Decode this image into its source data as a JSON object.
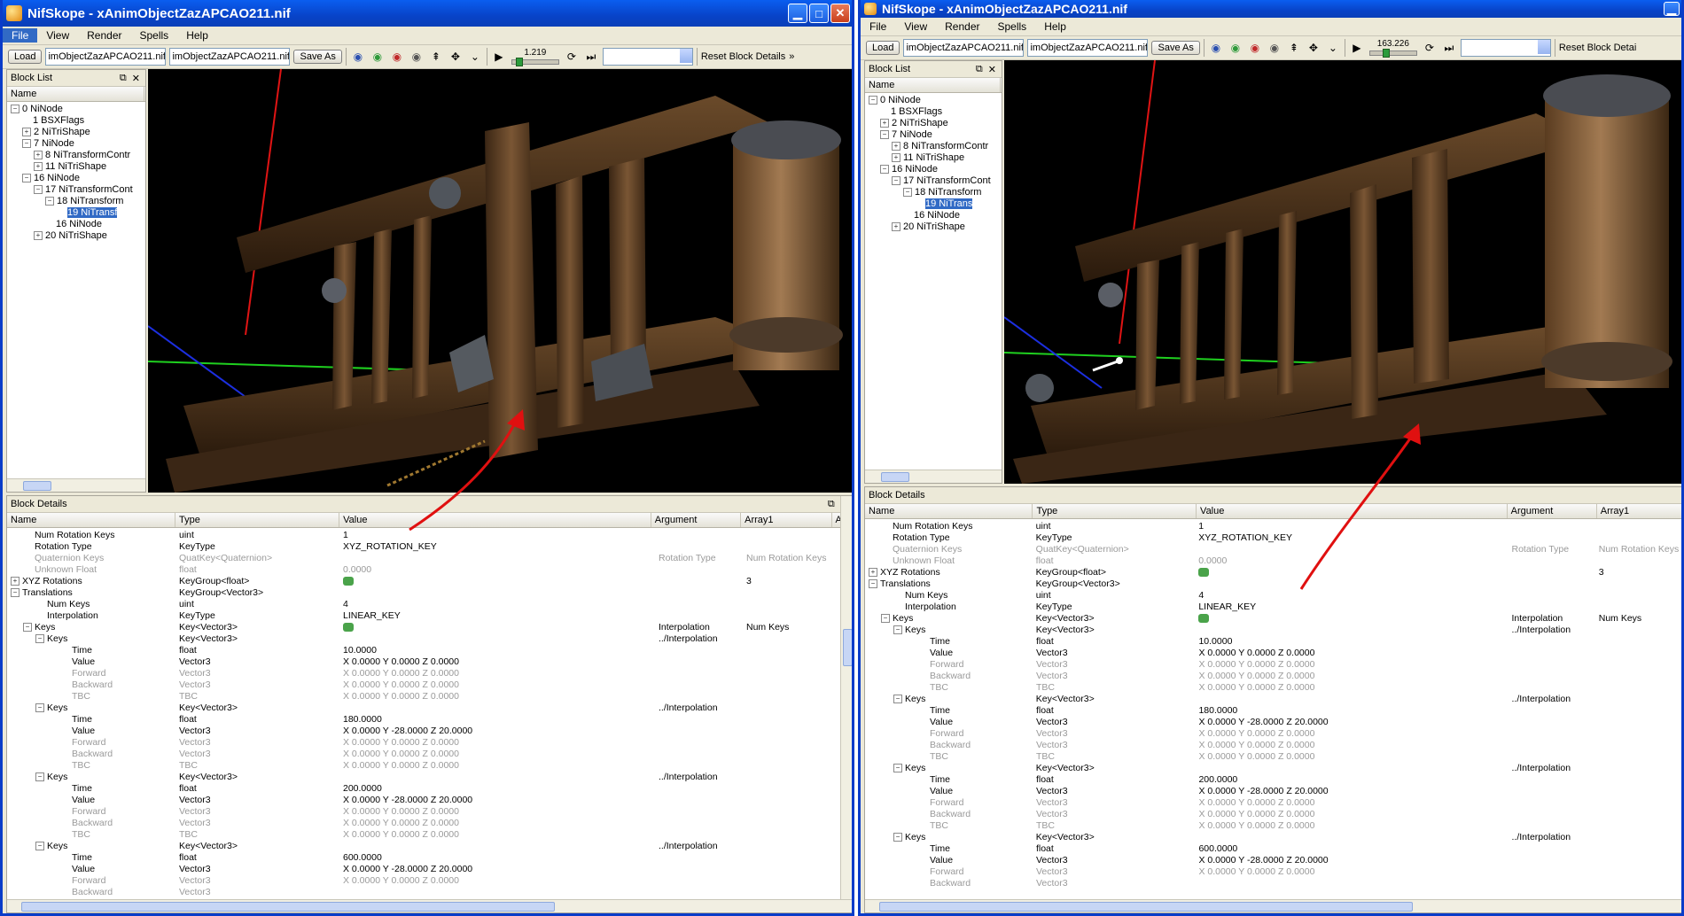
{
  "colors": {
    "titlebar": "#0a5ef0",
    "accent": "#316ac5",
    "arrow": "#e01010"
  },
  "win1": {
    "title": "NifSkope - xAnimObjectZazAPCAO211.nif",
    "menu": [
      "File",
      "View",
      "Render",
      "Spells",
      "Help"
    ],
    "toolbar": {
      "load": "Load",
      "file1": "imObjectZazAPCAO211.nif",
      "file2": "imObjectZazAPCAO211.nif",
      "save_as": "Save As",
      "time": "1.219",
      "reset": "Reset Block Details",
      "more": "»"
    },
    "block_list": {
      "title": "Block List",
      "col": "Name",
      "rows": [
        {
          "label": "0 NiNode",
          "exp": "−",
          "indent": 0
        },
        {
          "label": "1 BSXFlags",
          "exp": "",
          "indent": 1
        },
        {
          "label": "2 NiTriShape",
          "exp": "+",
          "indent": 1
        },
        {
          "label": "7 NiNode",
          "exp": "−",
          "indent": 1
        },
        {
          "label": "8 NiTransformContr",
          "exp": "+",
          "indent": 2
        },
        {
          "label": "11 NiTriShape",
          "exp": "+",
          "indent": 2
        },
        {
          "label": "16 NiNode",
          "exp": "−",
          "indent": 1
        },
        {
          "label": "17 NiTransformCont",
          "exp": "−",
          "indent": 2
        },
        {
          "label": "18 NiTransform",
          "exp": "−",
          "indent": 3
        },
        {
          "label": "19 NiTransf",
          "exp": "",
          "indent": 4,
          "selected": true
        },
        {
          "label": "16 NiNode",
          "exp": "",
          "indent": 3
        },
        {
          "label": "20 NiTriShape",
          "exp": "+",
          "indent": 2
        }
      ]
    },
    "details": {
      "title": "Block Details",
      "cols": [
        "Name",
        "Type",
        "Value",
        "Argument",
        "Array1",
        "Ar"
      ],
      "rows": [
        {
          "n": "Num Rotation Keys",
          "t": "uint",
          "v": "1",
          "a": "",
          "a1": "",
          "i": 1
        },
        {
          "n": "Rotation Type",
          "t": "KeyType",
          "v": "XYZ_ROTATION_KEY",
          "a": "",
          "a1": "",
          "i": 1
        },
        {
          "n": "Quaternion Keys",
          "t": "QuatKey<Quaternion>",
          "v": "",
          "a": "Rotation Type",
          "a1": "Num Rotation Keys",
          "i": 1,
          "g": true
        },
        {
          "n": "Unknown Float",
          "t": "float",
          "v": "0.0000",
          "a": "",
          "a1": "",
          "i": 1,
          "g": true
        },
        {
          "n": "XYZ Rotations",
          "t": "KeyGroup<float>",
          "v": "",
          "icon": true,
          "a": "",
          "a1": "3",
          "i": 0,
          "e": "+"
        },
        {
          "n": "Translations",
          "t": "KeyGroup<Vector3>",
          "v": "",
          "a": "",
          "a1": "",
          "i": 0,
          "e": "−"
        },
        {
          "n": "Num Keys",
          "t": "uint",
          "v": "4",
          "a": "",
          "a1": "",
          "i": 2
        },
        {
          "n": "Interpolation",
          "t": "KeyType",
          "v": "LINEAR_KEY",
          "a": "",
          "a1": "",
          "i": 2
        },
        {
          "n": "Keys",
          "t": "Key<Vector3>",
          "v": "",
          "icon": true,
          "a": "Interpolation",
          "a1": "Num Keys",
          "i": 1,
          "e": "−"
        },
        {
          "n": "Keys",
          "t": "Key<Vector3>",
          "v": "",
          "a": "../Interpolation",
          "a1": "",
          "i": 2,
          "e": "−"
        },
        {
          "n": "Time",
          "t": "float",
          "v": "10.0000",
          "a": "",
          "a1": "",
          "i": 4
        },
        {
          "n": "Value",
          "t": "Vector3",
          "v": "X 0.0000 Y 0.0000 Z 0.0000",
          "a": "",
          "a1": "",
          "i": 4
        },
        {
          "n": "Forward",
          "t": "Vector3",
          "v": "X 0.0000 Y 0.0000 Z 0.0000",
          "a": "",
          "a1": "",
          "i": 4,
          "g": true
        },
        {
          "n": "Backward",
          "t": "Vector3",
          "v": "X 0.0000 Y 0.0000 Z 0.0000",
          "a": "",
          "a1": "",
          "i": 4,
          "g": true
        },
        {
          "n": "TBC",
          "t": "TBC",
          "v": "X 0.0000 Y 0.0000 Z 0.0000",
          "a": "",
          "a1": "",
          "i": 4,
          "g": true
        },
        {
          "n": "Keys",
          "t": "Key<Vector3>",
          "v": "",
          "a": "../Interpolation",
          "a1": "",
          "i": 2,
          "e": "−"
        },
        {
          "n": "Time",
          "t": "float",
          "v": "180.0000",
          "a": "",
          "a1": "",
          "i": 4
        },
        {
          "n": "Value",
          "t": "Vector3",
          "v": "X 0.0000 Y -28.0000 Z 20.0000",
          "a": "",
          "a1": "",
          "i": 4
        },
        {
          "n": "Forward",
          "t": "Vector3",
          "v": "X 0.0000 Y 0.0000 Z 0.0000",
          "a": "",
          "a1": "",
          "i": 4,
          "g": true
        },
        {
          "n": "Backward",
          "t": "Vector3",
          "v": "X 0.0000 Y 0.0000 Z 0.0000",
          "a": "",
          "a1": "",
          "i": 4,
          "g": true
        },
        {
          "n": "TBC",
          "t": "TBC",
          "v": "X 0.0000 Y 0.0000 Z 0.0000",
          "a": "",
          "a1": "",
          "i": 4,
          "g": true
        },
        {
          "n": "Keys",
          "t": "Key<Vector3>",
          "v": "",
          "a": "../Interpolation",
          "a1": "",
          "i": 2,
          "e": "−"
        },
        {
          "n": "Time",
          "t": "float",
          "v": "200.0000",
          "a": "",
          "a1": "",
          "i": 4
        },
        {
          "n": "Value",
          "t": "Vector3",
          "v": "X 0.0000 Y -28.0000 Z 20.0000",
          "a": "",
          "a1": "",
          "i": 4
        },
        {
          "n": "Forward",
          "t": "Vector3",
          "v": "X 0.0000 Y 0.0000 Z 0.0000",
          "a": "",
          "a1": "",
          "i": 4,
          "g": true
        },
        {
          "n": "Backward",
          "t": "Vector3",
          "v": "X 0.0000 Y 0.0000 Z 0.0000",
          "a": "",
          "a1": "",
          "i": 4,
          "g": true
        },
        {
          "n": "TBC",
          "t": "TBC",
          "v": "X 0.0000 Y 0.0000 Z 0.0000",
          "a": "",
          "a1": "",
          "i": 4,
          "g": true
        },
        {
          "n": "Keys",
          "t": "Key<Vector3>",
          "v": "",
          "a": "../Interpolation",
          "a1": "",
          "i": 2,
          "e": "−"
        },
        {
          "n": "Time",
          "t": "float",
          "v": "600.0000",
          "a": "",
          "a1": "",
          "i": 4
        },
        {
          "n": "Value",
          "t": "Vector3",
          "v": "X 0.0000 Y -28.0000 Z 20.0000",
          "a": "",
          "a1": "",
          "i": 4
        },
        {
          "n": "Forward",
          "t": "Vector3",
          "v": "X 0.0000 Y 0.0000 Z 0.0000",
          "a": "",
          "a1": "",
          "i": 4,
          "g": true
        },
        {
          "n": "Backward",
          "t": "Vector3",
          "v": "",
          "a": "",
          "a1": "",
          "i": 4,
          "g": true
        }
      ]
    }
  },
  "win2": {
    "title": "NifSkope - xAnimObjectZazAPCAO211.nif",
    "menu": [
      "File",
      "View",
      "Render",
      "Spells",
      "Help"
    ],
    "toolbar": {
      "load": "Load",
      "file1": "imObjectZazAPCAO211.nif",
      "file2": "imObjectZazAPCAO211.nif",
      "save_as": "Save As",
      "time": "163.226",
      "reset": "Reset Block Detai"
    },
    "block_list": {
      "title": "Block List",
      "col": "Name",
      "rows": [
        {
          "label": "0 NiNode",
          "exp": "−",
          "indent": 0
        },
        {
          "label": "1 BSXFlags",
          "exp": "",
          "indent": 1
        },
        {
          "label": "2 NiTriShape",
          "exp": "+",
          "indent": 1
        },
        {
          "label": "7 NiNode",
          "exp": "−",
          "indent": 1
        },
        {
          "label": "8 NiTransformContr",
          "exp": "+",
          "indent": 2
        },
        {
          "label": "11 NiTriShape",
          "exp": "+",
          "indent": 2
        },
        {
          "label": "16 NiNode",
          "exp": "−",
          "indent": 1
        },
        {
          "label": "17 NiTransformCont",
          "exp": "−",
          "indent": 2
        },
        {
          "label": "18 NiTransform",
          "exp": "−",
          "indent": 3
        },
        {
          "label": "19 NiTrans",
          "exp": "",
          "indent": 4,
          "selected": true
        },
        {
          "label": "16 NiNode",
          "exp": "",
          "indent": 3
        },
        {
          "label": "20 NiTriShape",
          "exp": "+",
          "indent": 2
        }
      ]
    },
    "details": {
      "title": "Block Details",
      "cols": [
        "Name",
        "Type",
        "Value",
        "Argument",
        "Array1"
      ],
      "rows": [
        {
          "n": "Num Rotation Keys",
          "t": "uint",
          "v": "1",
          "a": "",
          "a1": "",
          "i": 1
        },
        {
          "n": "Rotation Type",
          "t": "KeyType",
          "v": "XYZ_ROTATION_KEY",
          "a": "",
          "a1": "",
          "i": 1
        },
        {
          "n": "Quaternion Keys",
          "t": "QuatKey<Quaternion>",
          "v": "",
          "a": "Rotation Type",
          "a1": "Num Rotation Keys",
          "i": 1,
          "g": true
        },
        {
          "n": "Unknown Float",
          "t": "float",
          "v": "0.0000",
          "a": "",
          "a1": "",
          "i": 1,
          "g": true
        },
        {
          "n": "XYZ Rotations",
          "t": "KeyGroup<float>",
          "v": "",
          "icon": true,
          "a": "",
          "a1": "3",
          "i": 0,
          "e": "+"
        },
        {
          "n": "Translations",
          "t": "KeyGroup<Vector3>",
          "v": "",
          "a": "",
          "a1": "",
          "i": 0,
          "e": "−"
        },
        {
          "n": "Num Keys",
          "t": "uint",
          "v": "4",
          "a": "",
          "a1": "",
          "i": 2
        },
        {
          "n": "Interpolation",
          "t": "KeyType",
          "v": "LINEAR_KEY",
          "a": "",
          "a1": "",
          "i": 2
        },
        {
          "n": "Keys",
          "t": "Key<Vector3>",
          "v": "",
          "icon": true,
          "a": "Interpolation",
          "a1": "Num Keys",
          "i": 1,
          "e": "−"
        },
        {
          "n": "Keys",
          "t": "Key<Vector3>",
          "v": "",
          "a": "../Interpolation",
          "a1": "",
          "i": 2,
          "e": "−"
        },
        {
          "n": "Time",
          "t": "float",
          "v": "10.0000",
          "a": "",
          "a1": "",
          "i": 4
        },
        {
          "n": "Value",
          "t": "Vector3",
          "v": "X 0.0000 Y 0.0000 Z 0.0000",
          "a": "",
          "a1": "",
          "i": 4
        },
        {
          "n": "Forward",
          "t": "Vector3",
          "v": "X 0.0000 Y 0.0000 Z 0.0000",
          "a": "",
          "a1": "",
          "i": 4,
          "g": true
        },
        {
          "n": "Backward",
          "t": "Vector3",
          "v": "X 0.0000 Y 0.0000 Z 0.0000",
          "a": "",
          "a1": "",
          "i": 4,
          "g": true
        },
        {
          "n": "TBC",
          "t": "TBC",
          "v": "X 0.0000 Y 0.0000 Z 0.0000",
          "a": "",
          "a1": "",
          "i": 4,
          "g": true
        },
        {
          "n": "Keys",
          "t": "Key<Vector3>",
          "v": "",
          "a": "../Interpolation",
          "a1": "",
          "i": 2,
          "e": "−"
        },
        {
          "n": "Time",
          "t": "float",
          "v": "180.0000",
          "a": "",
          "a1": "",
          "i": 4
        },
        {
          "n": "Value",
          "t": "Vector3",
          "v": "X 0.0000 Y -28.0000 Z 20.0000",
          "a": "",
          "a1": "",
          "i": 4
        },
        {
          "n": "Forward",
          "t": "Vector3",
          "v": "X 0.0000 Y 0.0000 Z 0.0000",
          "a": "",
          "a1": "",
          "i": 4,
          "g": true
        },
        {
          "n": "Backward",
          "t": "Vector3",
          "v": "X 0.0000 Y 0.0000 Z 0.0000",
          "a": "",
          "a1": "",
          "i": 4,
          "g": true
        },
        {
          "n": "TBC",
          "t": "TBC",
          "v": "X 0.0000 Y 0.0000 Z 0.0000",
          "a": "",
          "a1": "",
          "i": 4,
          "g": true
        },
        {
          "n": "Keys",
          "t": "Key<Vector3>",
          "v": "",
          "a": "../Interpolation",
          "a1": "",
          "i": 2,
          "e": "−"
        },
        {
          "n": "Time",
          "t": "float",
          "v": "200.0000",
          "a": "",
          "a1": "",
          "i": 4
        },
        {
          "n": "Value",
          "t": "Vector3",
          "v": "X 0.0000 Y -28.0000 Z 20.0000",
          "a": "",
          "a1": "",
          "i": 4
        },
        {
          "n": "Forward",
          "t": "Vector3",
          "v": "X 0.0000 Y 0.0000 Z 0.0000",
          "a": "",
          "a1": "",
          "i": 4,
          "g": true
        },
        {
          "n": "Backward",
          "t": "Vector3",
          "v": "X 0.0000 Y 0.0000 Z 0.0000",
          "a": "",
          "a1": "",
          "i": 4,
          "g": true
        },
        {
          "n": "TBC",
          "t": "TBC",
          "v": "X 0.0000 Y 0.0000 Z 0.0000",
          "a": "",
          "a1": "",
          "i": 4,
          "g": true
        },
        {
          "n": "Keys",
          "t": "Key<Vector3>",
          "v": "",
          "a": "../Interpolation",
          "a1": "",
          "i": 2,
          "e": "−"
        },
        {
          "n": "Time",
          "t": "float",
          "v": "600.0000",
          "a": "",
          "a1": "",
          "i": 4
        },
        {
          "n": "Value",
          "t": "Vector3",
          "v": "X 0.0000 Y -28.0000 Z 20.0000",
          "a": "",
          "a1": "",
          "i": 4
        },
        {
          "n": "Forward",
          "t": "Vector3",
          "v": "X 0.0000 Y 0.0000 Z 0.0000",
          "a": "",
          "a1": "",
          "i": 4,
          "g": true
        },
        {
          "n": "Backward",
          "t": "Vector3",
          "v": "",
          "a": "",
          "a1": "",
          "i": 4,
          "g": true
        }
      ]
    }
  }
}
